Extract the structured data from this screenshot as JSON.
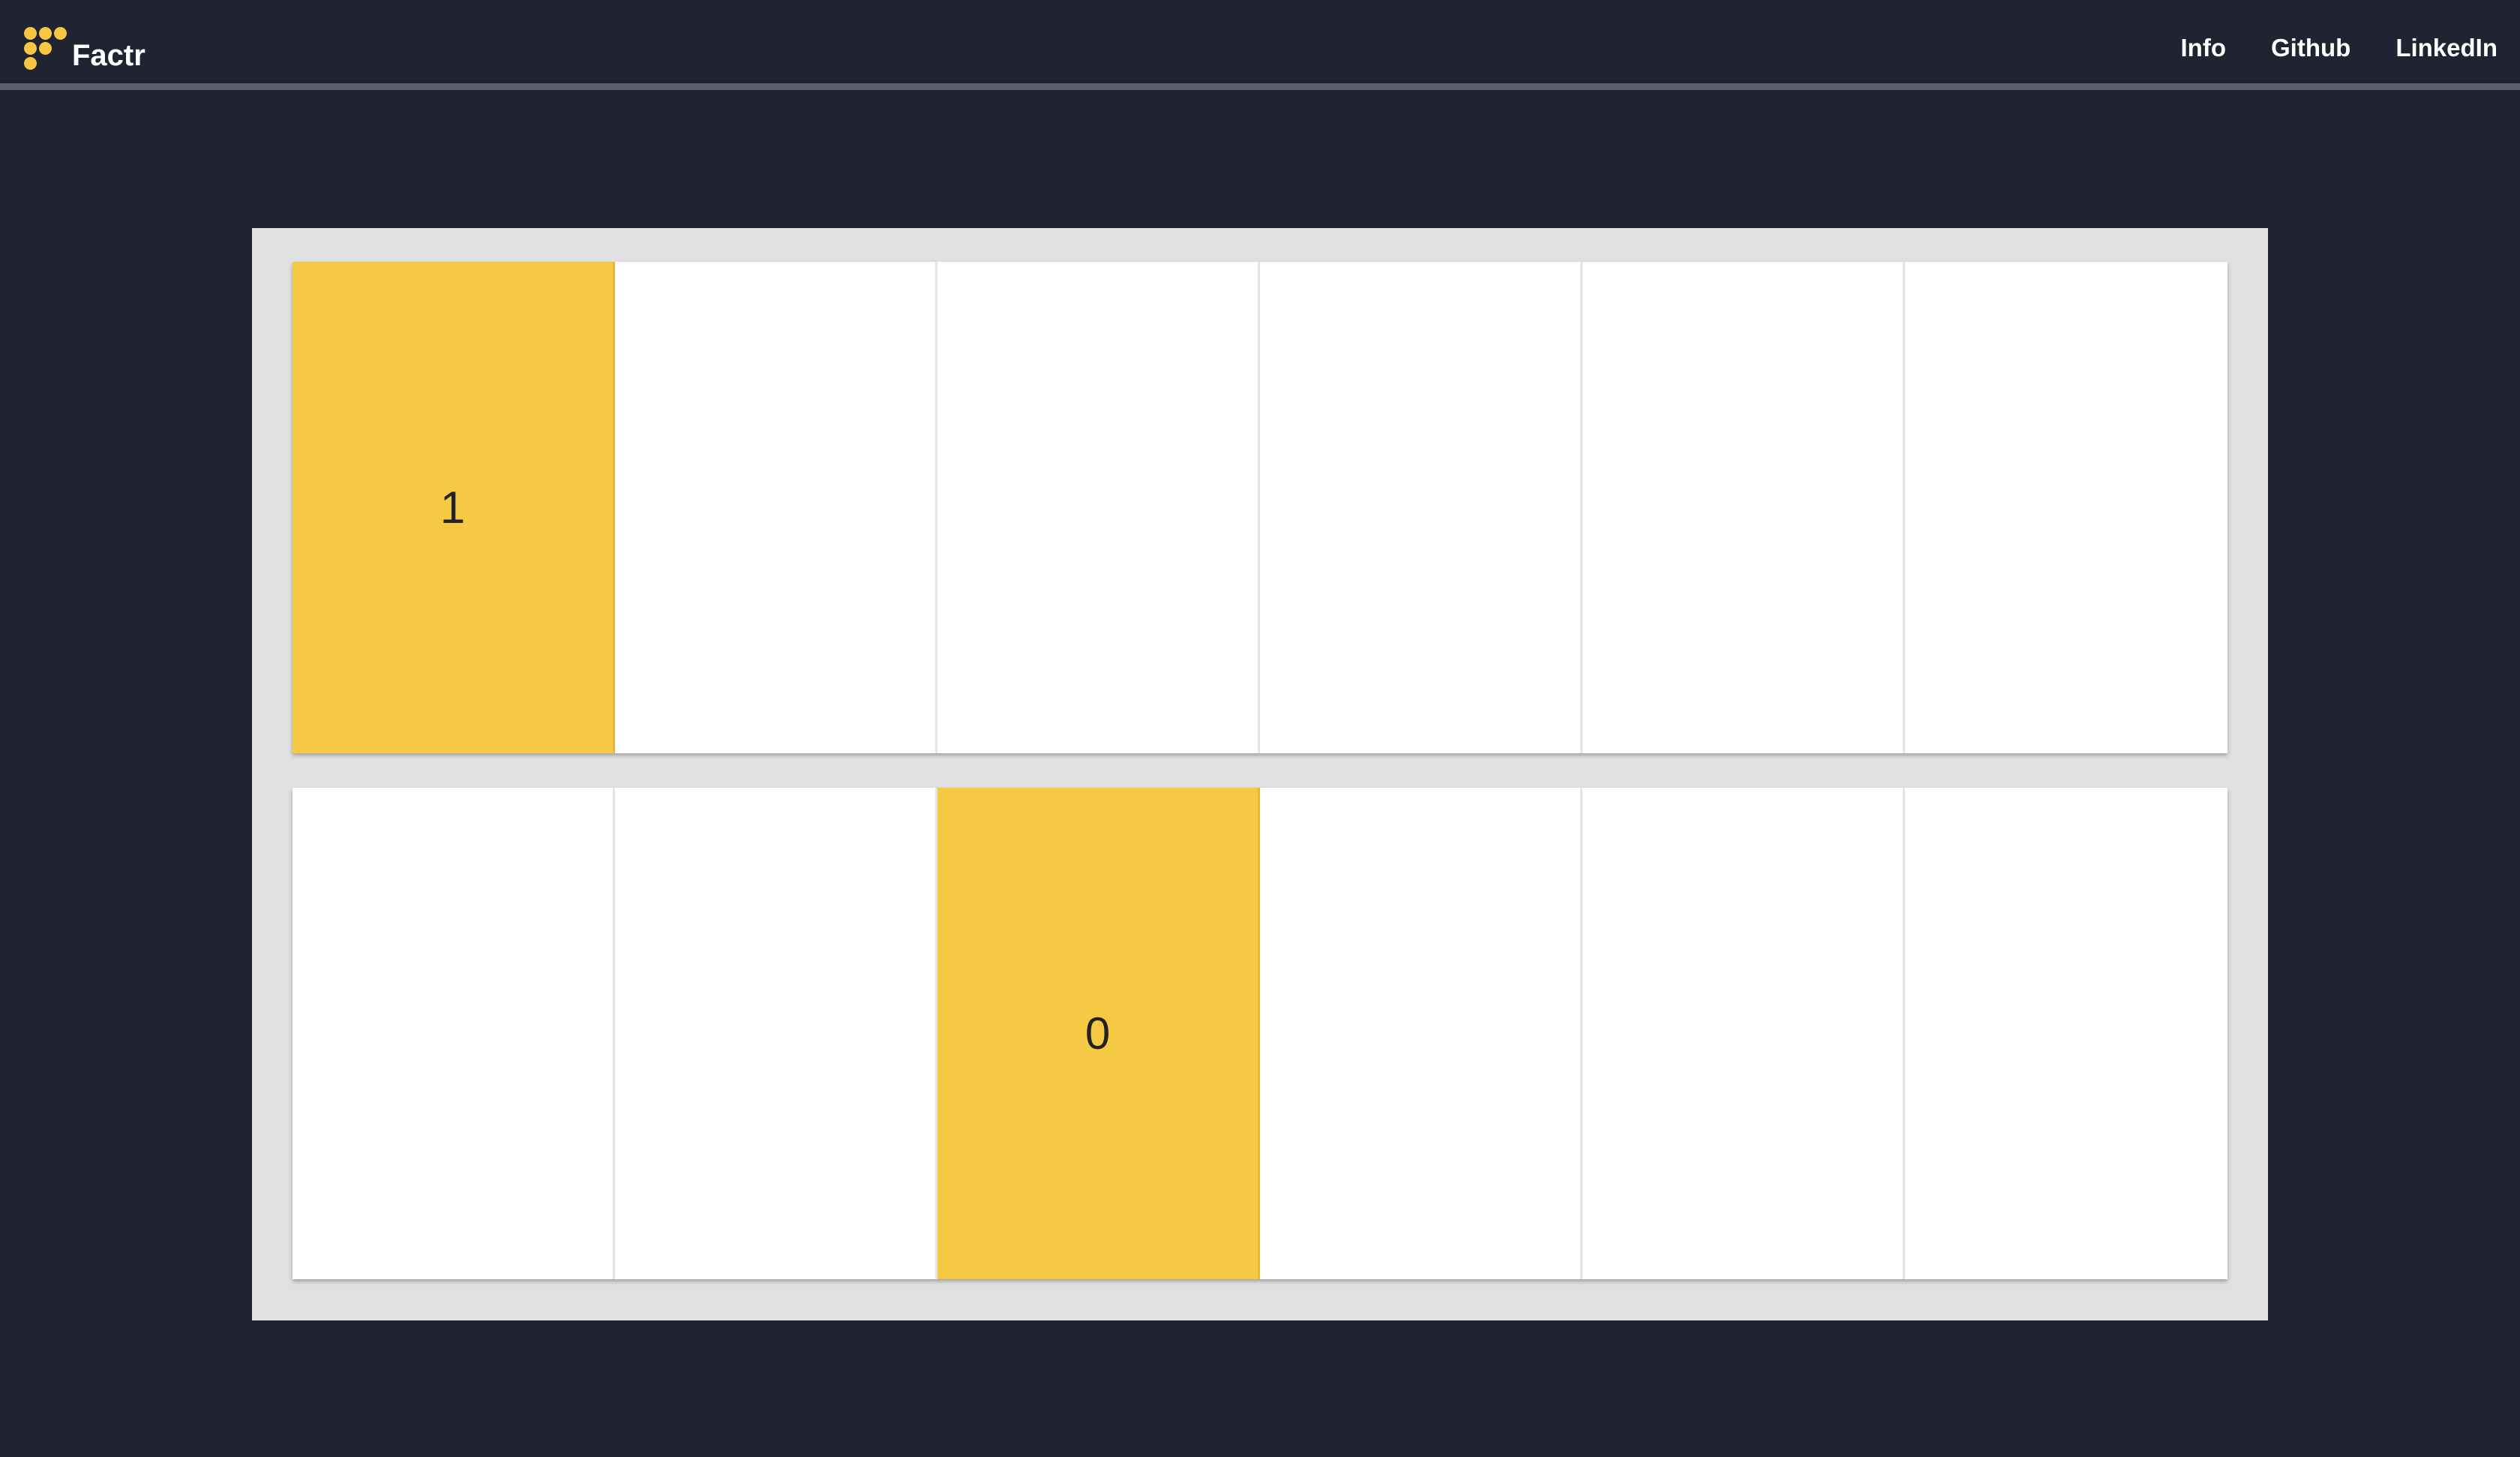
{
  "navbar": {
    "brand": "Factr",
    "logo_icon": "factr-dots-logo-icon",
    "links": [
      "Info",
      "Github",
      "LinkedIn"
    ]
  },
  "colors": {
    "background": "#1f2332",
    "accent": "#f6c944",
    "board": "#e0e0e0",
    "cell": "#ffffff"
  },
  "board": {
    "rows": [
      {
        "cells": [
          "1",
          "",
          "",
          "",
          "",
          ""
        ],
        "active_index": 0
      },
      {
        "cells": [
          "",
          "",
          "0",
          "",
          "",
          ""
        ],
        "active_index": 2
      }
    ]
  }
}
